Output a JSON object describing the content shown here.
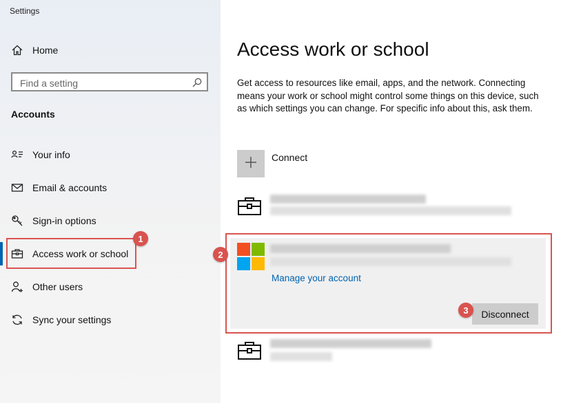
{
  "app": {
    "title": "Settings"
  },
  "sidebar": {
    "home_label": "Home",
    "search_placeholder": "Find a setting",
    "section_label": "Accounts",
    "items": [
      {
        "label": "Your info",
        "icon": "person-card-icon"
      },
      {
        "label": "Email & accounts",
        "icon": "mail-icon"
      },
      {
        "label": "Sign-in options",
        "icon": "key-icon"
      },
      {
        "label": "Access work or school",
        "icon": "briefcase-icon",
        "active": true
      },
      {
        "label": "Other users",
        "icon": "person-add-icon"
      },
      {
        "label": "Sync your settings",
        "icon": "sync-icon"
      }
    ]
  },
  "main": {
    "title": "Access work or school",
    "description": "Get access to resources like email, apps, and the network. Connecting means your work or school might control some things on this device, such as which settings you can change. For specific info about this, ask them.",
    "connect_label": "Connect",
    "selected_account": {
      "manage_link": "Manage your account",
      "disconnect_label": "Disconnect"
    }
  },
  "annotations": {
    "badge1": "1",
    "badge2": "2",
    "badge3": "3",
    "color": "#d9534f"
  },
  "colors": {
    "accent": "#0063b1",
    "ms_red": "#f25022",
    "ms_green": "#7fba00",
    "ms_blue": "#00a4ef",
    "ms_yellow": "#ffb900"
  }
}
